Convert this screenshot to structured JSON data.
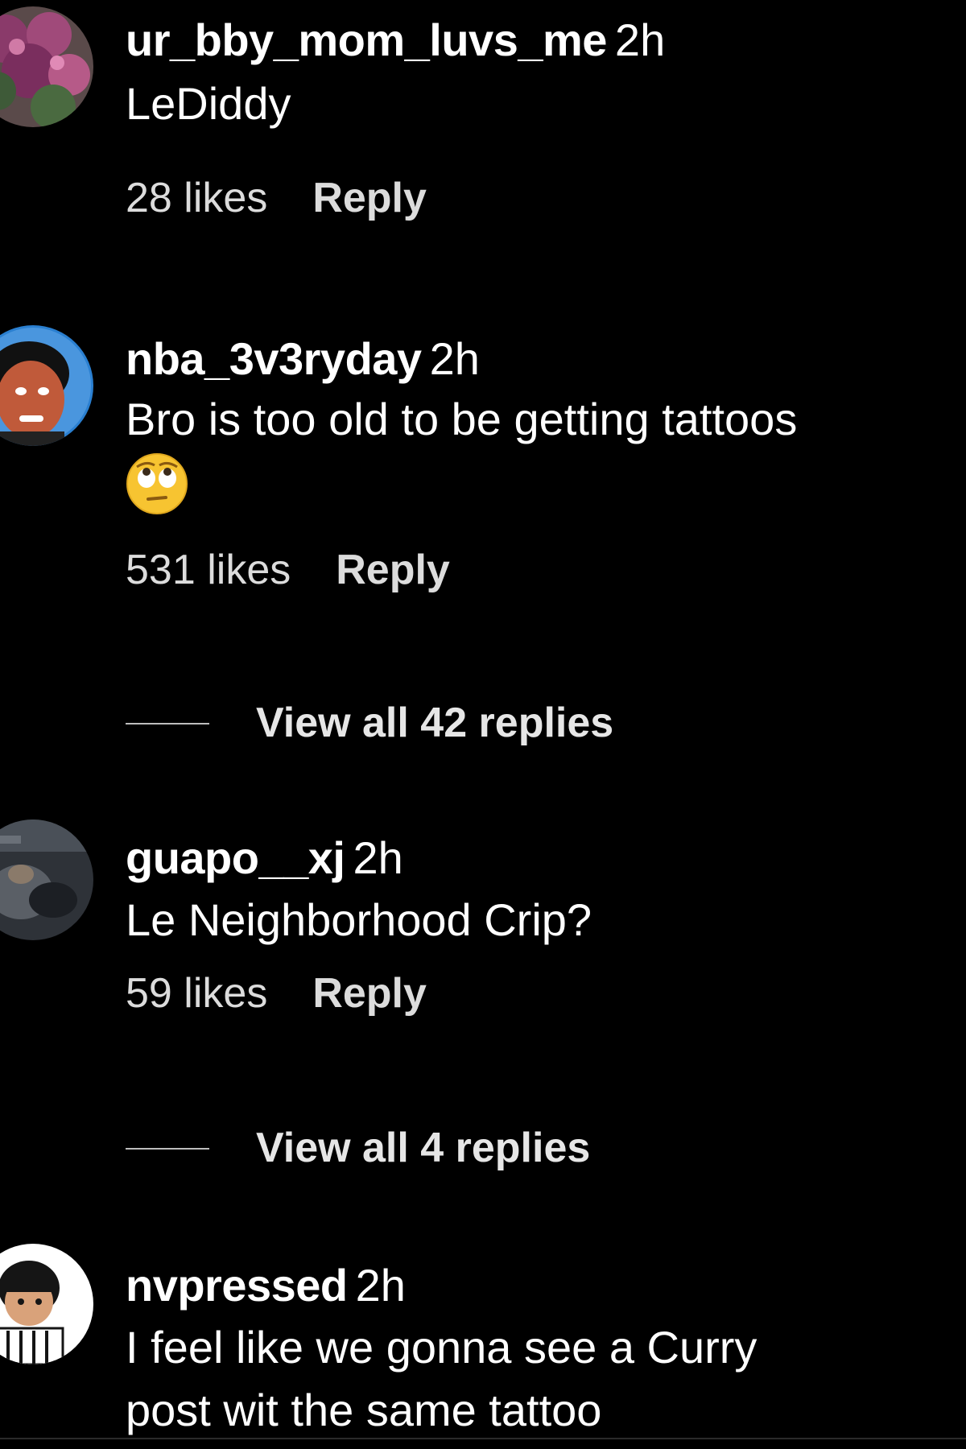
{
  "comments": [
    {
      "username": "ur_bby_mom_luvs_me",
      "time": "2h",
      "text": "LeDiddy",
      "likes": "28 likes",
      "reply": "Reply",
      "avatar_icon": "flowers-avatar"
    },
    {
      "username": "nba_3v3ryday",
      "time": "2h",
      "text": "Bro is too old to be getting tattoos",
      "emoji": "face-with-rolling-eyes",
      "likes": "531 likes",
      "reply": "Reply",
      "view_replies": "View all 42 replies",
      "avatar_icon": "person-face-avatar"
    },
    {
      "username": "guapo__xj",
      "time": "2h",
      "text": "Le Neighborhood Crip?",
      "likes": "59 likes",
      "reply": "Reply",
      "view_replies": "View all 4 replies",
      "avatar_icon": "dark-photo-avatar"
    },
    {
      "username": "nvpressed",
      "time": "2h",
      "text_line1": "I feel like we gonna see a Curry",
      "text_line2": "post wit the same tattoo",
      "avatar_icon": "cartoon-character-avatar"
    }
  ],
  "colors": {
    "background": "#000000",
    "text": "#ffffff",
    "secondary_text": "#dcdcdc"
  }
}
